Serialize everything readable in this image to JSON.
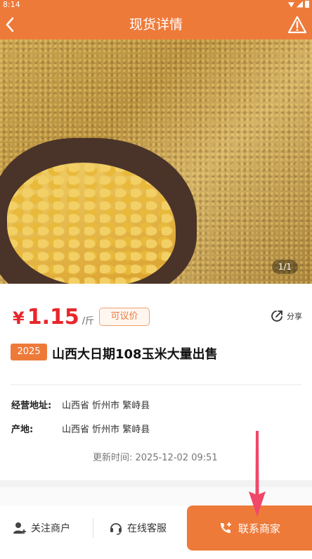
{
  "status_bar": {
    "time": "8:14"
  },
  "nav": {
    "title": "现货详情"
  },
  "gallery": {
    "counter": "1/1"
  },
  "price": {
    "symbol": "¥",
    "value": "1.15",
    "unit": "/斤",
    "negotiable": "可议价"
  },
  "share": {
    "label": "分享"
  },
  "product": {
    "year": "2025",
    "title": "山西大日期108玉米大量出售"
  },
  "details": {
    "address_label": "经营地址:",
    "address_value": "山西省 忻州市 繁峙县",
    "origin_label": "产地:",
    "origin_value": "山西省 忻州市 繁峙县"
  },
  "update": {
    "text": "更新时间: 2025-12-02 09:51"
  },
  "bottom": {
    "follow": "关注商户",
    "service": "在线客服",
    "contact": "联系商家"
  },
  "colors": {
    "accent": "#ee7a3a",
    "price": "#e8262a",
    "annotation": "#f0476a"
  }
}
